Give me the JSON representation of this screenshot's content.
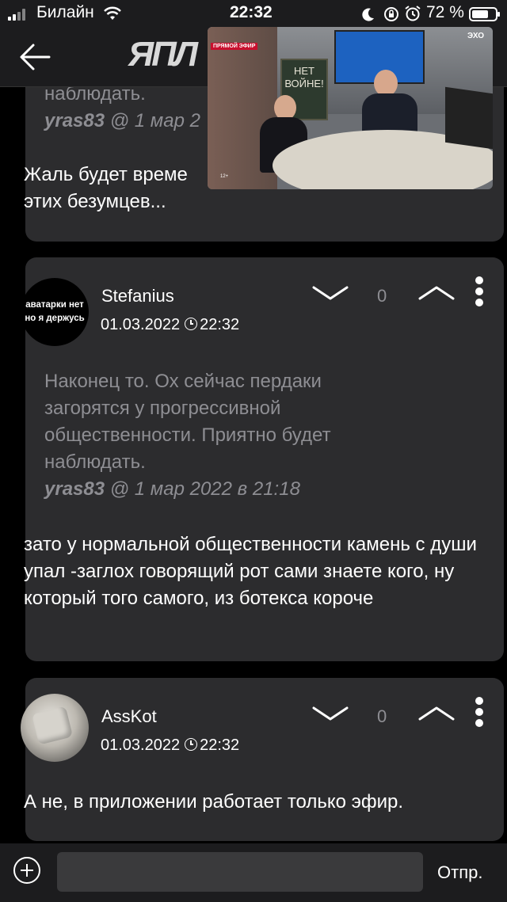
{
  "status": {
    "carrier": "Билайн",
    "time": "22:32",
    "battery": "72 %",
    "battery_level": 0.72
  },
  "nav": {
    "logo": "ЯПЛ"
  },
  "comments": [
    {
      "quote_tail": "наблюдать.",
      "quote_meta_user": "yras83",
      "quote_meta_rest": " @ 1 мар 2",
      "text": "Жаль будет време\nэтих безумцев..."
    },
    {
      "avatar_text": "аватарки нет\nно я держусь",
      "user": "Stefanius",
      "date": "01.03.2022",
      "time": "22:32",
      "score": "0",
      "quote": "Наконец то. Ох сейчас пердаки загорятся у прогрессивной общественности. Приятно будет наблюдать.",
      "quote_meta_user": "yras83",
      "quote_meta_rest": " @ 1 мар 2022 в 21:18",
      "text": "зато у нормальной общественности камень с души упал -заглох говорящий рот сами знаете кого, ну который того самого, из ботекса короче"
    },
    {
      "user": "AssKot",
      "date": "01.03.2022",
      "time": "22:32",
      "score": "0",
      "text": "А не, в приложении работает только эфир."
    }
  ],
  "pip": {
    "live_badge": "ПРЯМОЙ ЭФИР",
    "board_text": "НЕТ\nВОЙНЕ!",
    "channel": "ЭХО",
    "age": "12+"
  },
  "composer": {
    "placeholder": "",
    "send_label": "Отпр."
  }
}
